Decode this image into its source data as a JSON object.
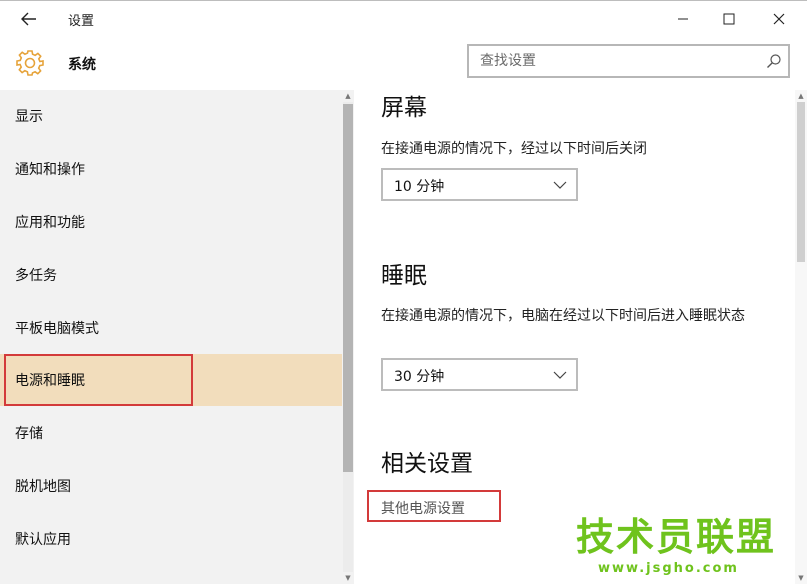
{
  "titlebar": {
    "title": "设置",
    "back_icon": "back-arrow-icon",
    "minimize_icon": "minimize-icon",
    "maximize_icon": "maximize-icon",
    "close_icon": "close-icon"
  },
  "header": {
    "icon": "gear-icon",
    "title": "系统",
    "search_placeholder": "查找设置",
    "search_icon": "search-icon"
  },
  "sidebar": {
    "items": [
      {
        "label": "显示",
        "selected": false
      },
      {
        "label": "通知和操作",
        "selected": false
      },
      {
        "label": "应用和功能",
        "selected": false
      },
      {
        "label": "多任务",
        "selected": false
      },
      {
        "label": "平板电脑模式",
        "selected": false
      },
      {
        "label": "电源和睡眠",
        "selected": true
      },
      {
        "label": "存储",
        "selected": false
      },
      {
        "label": "脱机地图",
        "selected": false
      },
      {
        "label": "默认应用",
        "selected": false
      }
    ]
  },
  "content": {
    "screen": {
      "title": "屏幕",
      "description": "在接通电源的情况下，经过以下时间后关闭",
      "dropdown_value": "10 分钟"
    },
    "sleep": {
      "title": "睡眠",
      "description": "在接通电源的情况下，电脑在经过以下时间后进入睡眠状态",
      "dropdown_value": "30 分钟"
    },
    "related": {
      "title": "相关设置",
      "link": "其他电源设置"
    }
  },
  "watermark": {
    "main": "技术员联盟",
    "sub": "www.jsgho.com"
  },
  "colors": {
    "selected_bg": "#f2ddbc",
    "highlight_border": "#d33a3a",
    "sidebar_bg": "#f2f2f2",
    "watermark": "#6fc31d"
  }
}
